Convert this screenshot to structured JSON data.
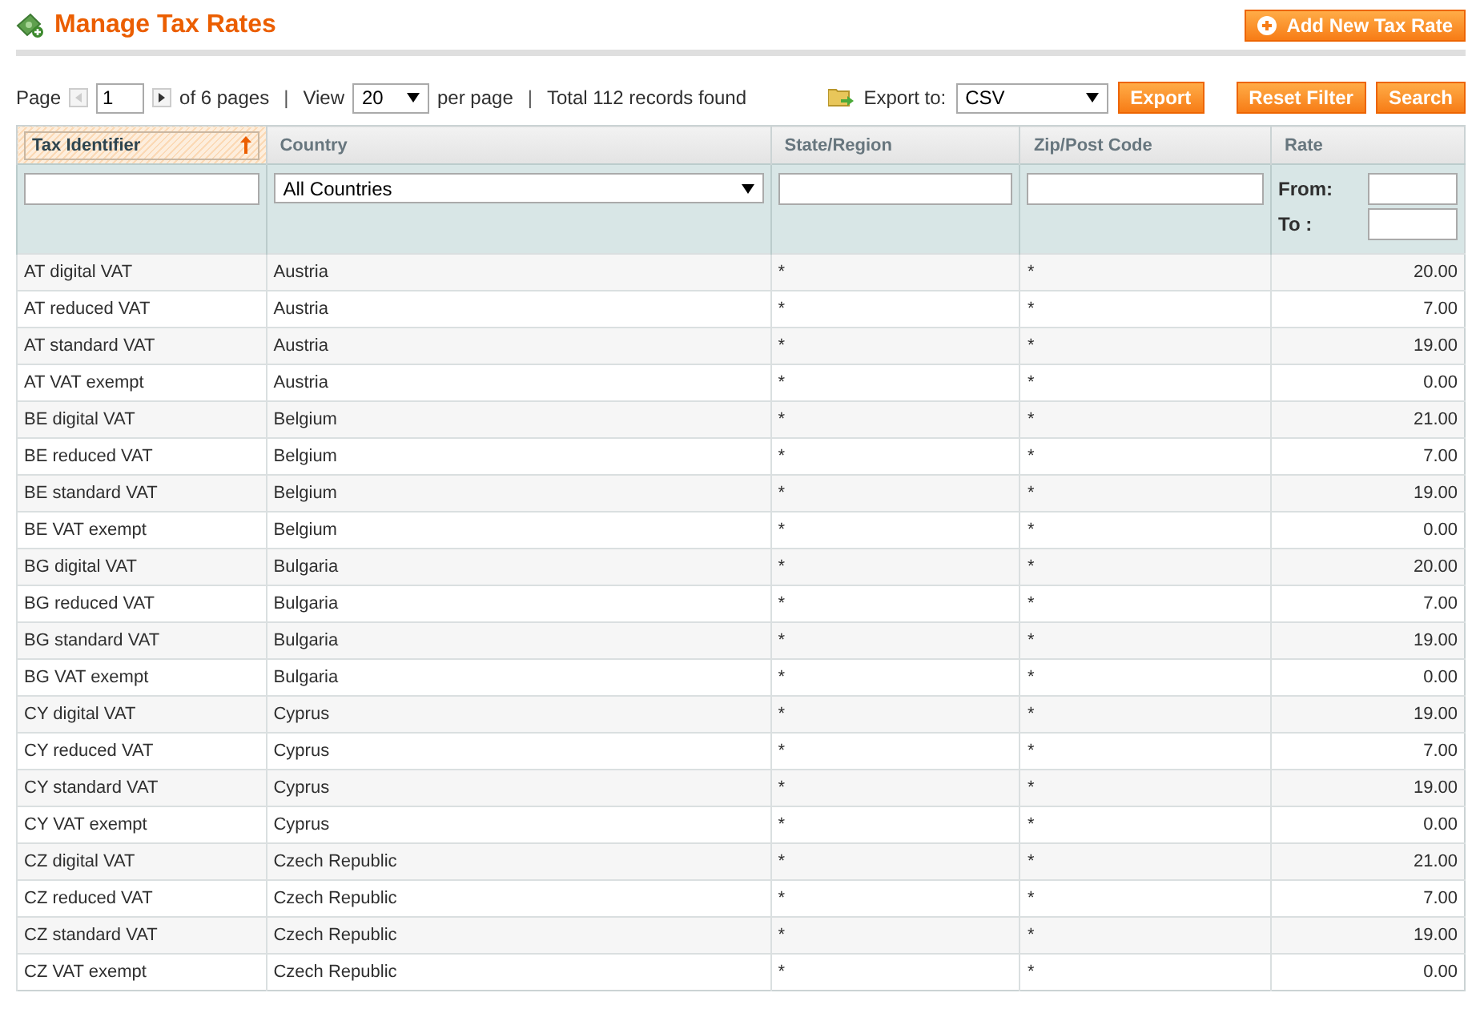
{
  "page_title": "Manage Tax Rates",
  "add_button": "Add New Tax Rate",
  "pager": {
    "page_label": "Page",
    "page": "1",
    "of_pages": "of 6 pages",
    "view_label": "View",
    "per_page": "20",
    "per_page_label": "per page",
    "separators": [
      "|",
      "|"
    ],
    "total": "Total 112 records found"
  },
  "export": {
    "label": "Export to:",
    "format": "CSV",
    "button": "Export"
  },
  "actions": [
    "Reset Filter",
    "Search"
  ],
  "columns": [
    {
      "label": "Tax Identifier",
      "sorted": true,
      "kind": "text"
    },
    {
      "label": "Country",
      "sorted": false,
      "kind": "select",
      "filter_value": "All Countries"
    },
    {
      "label": "State/Region",
      "sorted": false,
      "kind": "text"
    },
    {
      "label": "Zip/Post Code",
      "sorted": false,
      "kind": "text"
    },
    {
      "label": "Rate",
      "sorted": false,
      "kind": "range",
      "from_label": "From:",
      "to_label": "To :"
    }
  ],
  "rows": [
    [
      "AT digital VAT",
      "Austria",
      "*",
      "*",
      "20.00"
    ],
    [
      "AT reduced VAT",
      "Austria",
      "*",
      "*",
      "7.00"
    ],
    [
      "AT standard VAT",
      "Austria",
      "*",
      "*",
      "19.00"
    ],
    [
      "AT VAT exempt",
      "Austria",
      "*",
      "*",
      "0.00"
    ],
    [
      "BE digital VAT",
      "Belgium",
      "*",
      "*",
      "21.00"
    ],
    [
      "BE reduced VAT",
      "Belgium",
      "*",
      "*",
      "7.00"
    ],
    [
      "BE standard VAT",
      "Belgium",
      "*",
      "*",
      "19.00"
    ],
    [
      "BE VAT exempt",
      "Belgium",
      "*",
      "*",
      "0.00"
    ],
    [
      "BG digital VAT",
      "Bulgaria",
      "*",
      "*",
      "20.00"
    ],
    [
      "BG reduced VAT",
      "Bulgaria",
      "*",
      "*",
      "7.00"
    ],
    [
      "BG standard VAT",
      "Bulgaria",
      "*",
      "*",
      "19.00"
    ],
    [
      "BG VAT exempt",
      "Bulgaria",
      "*",
      "*",
      "0.00"
    ],
    [
      "CY digital VAT",
      "Cyprus",
      "*",
      "*",
      "19.00"
    ],
    [
      "CY reduced VAT",
      "Cyprus",
      "*",
      "*",
      "7.00"
    ],
    [
      "CY standard VAT",
      "Cyprus",
      "*",
      "*",
      "19.00"
    ],
    [
      "CY VAT exempt",
      "Cyprus",
      "*",
      "*",
      "0.00"
    ],
    [
      "CZ digital VAT",
      "Czech Republic",
      "*",
      "*",
      "21.00"
    ],
    [
      "CZ reduced VAT",
      "Czech Republic",
      "*",
      "*",
      "7.00"
    ],
    [
      "CZ standard VAT",
      "Czech Republic",
      "*",
      "*",
      "19.00"
    ],
    [
      "CZ VAT exempt",
      "Czech Republic",
      "*",
      "*",
      "0.00"
    ]
  ]
}
